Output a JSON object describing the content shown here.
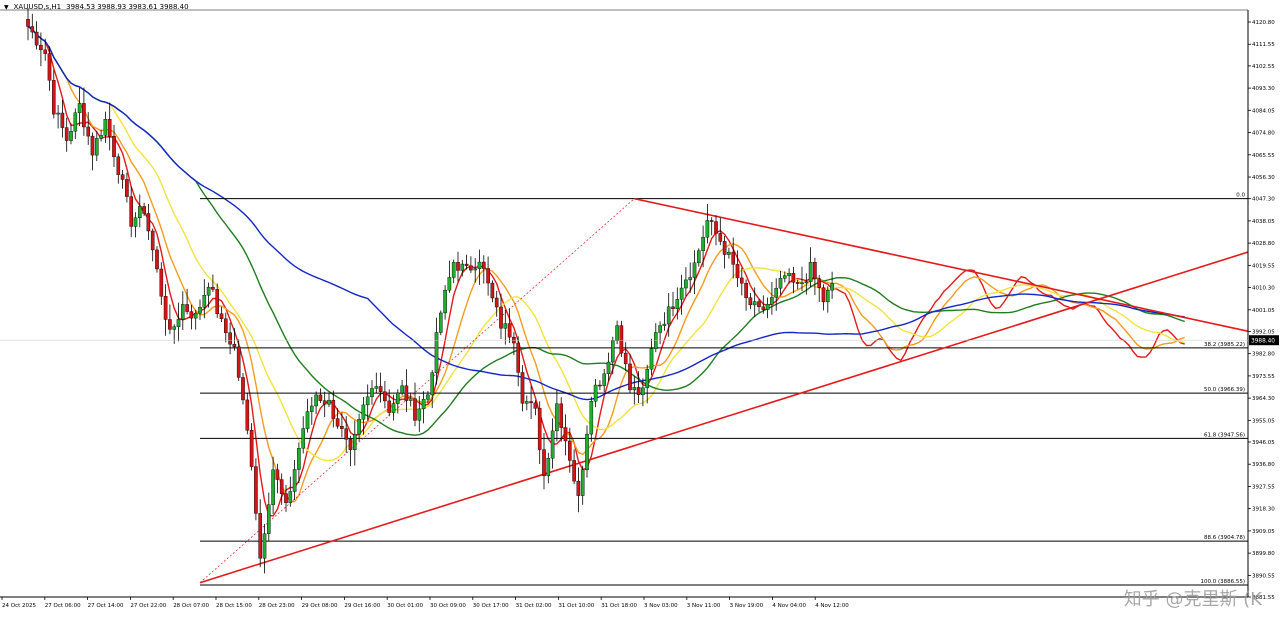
{
  "header": {
    "title": "XAUUSD,s,H1",
    "ohlc": "3984.53 3988.93 3983.61 3988.40"
  },
  "watermark": "知乎 @克里斯 (K",
  "colors": {
    "candle_up": "#1fae2e",
    "candle_down": "#d31515",
    "ma_red": "#e41a1a",
    "ma_orange": "#f59b1d",
    "ma_yellow": "#f2e43c",
    "ma_green": "#1e7d1e",
    "ma_blue": "#1226c9",
    "fib_line": "#000000",
    "trendline": "#e41a1a",
    "price_tag_bg": "#000000",
    "price_tag_text": "#ffffff"
  },
  "chart_data": {
    "type": "candlestick",
    "symbol": "XAUUSD,s,H1",
    "ylim": [
      3881.55,
      4125.8
    ],
    "y_ticks": [
      "4120.80",
      "4111.55",
      "4102.55",
      "4093.30",
      "4084.05",
      "4074.80",
      "4065.55",
      "4056.30",
      "4047.30",
      "4038.05",
      "4028.80",
      "4019.55",
      "4010.30",
      "4001.05",
      "3992.05",
      "3982.80",
      "3973.55",
      "3964.30",
      "3955.05",
      "3946.05",
      "3936.80",
      "3927.55",
      "3918.30",
      "3909.05",
      "3899.80",
      "3890.55",
      "3881.55"
    ],
    "x_labels": [
      "24 Oct 2025",
      "27 Oct 06:00",
      "27 Oct 14:00",
      "27 Oct 22:00",
      "28 Oct 07:00",
      "28 Oct 15:00",
      "28 Oct 23:00",
      "29 Oct 08:00",
      "29 Oct 16:00",
      "30 Oct 01:00",
      "30 Oct 09:00",
      "30 Oct 17:00",
      "31 Oct 02:00",
      "31 Oct 10:00",
      "31 Oct 18:00",
      "3 Nov 03:00",
      "3 Nov 11:00",
      "3 Nov 19:00",
      "4 Nov 04:00",
      "4 Nov 12:00"
    ],
    "current_price": "3988.40",
    "fib_levels": [
      {
        "label": "0.0",
        "price": 4047.3
      },
      {
        "label": "38.2 (3985.22)",
        "price": 3985.22
      },
      {
        "label": "50.0 (3966.39)",
        "price": 3966.39
      },
      {
        "label": "61.8 (3947.56)",
        "price": 3947.56
      },
      {
        "label": "88.6 (3904.78)",
        "price": 3904.78
      },
      {
        "label": "100.0 (3886.55)",
        "price": 3886.55
      }
    ],
    "trendlines": [
      {
        "name": "descending",
        "from": {
          "bar": 101,
          "price": 4047.3
        },
        "to": {
          "bar": 248,
          "price": 3990.5
        }
      },
      {
        "name": "ascending",
        "from": {
          "bar": 0,
          "price": 3887.5
        },
        "to": {
          "bar": 248,
          "price": 4027.5
        }
      }
    ],
    "guide_line": {
      "from": {
        "bar": 0,
        "price": 3887.5
      },
      "to": {
        "bar": 101,
        "price": 4047.3
      }
    },
    "anchors": [
      {
        "bar": -40,
        "price": 4119
      },
      {
        "bar": -36,
        "price": 4108
      },
      {
        "bar": -34,
        "price": 4085
      },
      {
        "bar": -31,
        "price": 4072
      },
      {
        "bar": -28,
        "price": 4086
      },
      {
        "bar": -25,
        "price": 4067
      },
      {
        "bar": -22,
        "price": 4080
      },
      {
        "bar": -19,
        "price": 4060
      },
      {
        "bar": -16,
        "price": 4038
      },
      {
        "bar": -13,
        "price": 4043
      },
      {
        "bar": -10,
        "price": 4017
      },
      {
        "bar": -7,
        "price": 3990
      },
      {
        "bar": -4,
        "price": 4003
      },
      {
        "bar": -1,
        "price": 3998
      },
      {
        "bar": 2,
        "price": 4013
      },
      {
        "bar": 5,
        "price": 3995
      },
      {
        "bar": 8,
        "price": 3985
      },
      {
        "bar": 10,
        "price": 3962
      },
      {
        "bar": 12,
        "price": 3938
      },
      {
        "bar": 14,
        "price": 3898
      },
      {
        "bar": 17,
        "price": 3935
      },
      {
        "bar": 20,
        "price": 3918
      },
      {
        "bar": 24,
        "price": 3952
      },
      {
        "bar": 27,
        "price": 3966
      },
      {
        "bar": 30,
        "price": 3962
      },
      {
        "bar": 33,
        "price": 3950
      },
      {
        "bar": 35,
        "price": 3940
      },
      {
        "bar": 38,
        "price": 3960
      },
      {
        "bar": 41,
        "price": 3972
      },
      {
        "bar": 44,
        "price": 3960
      },
      {
        "bar": 47,
        "price": 3968
      },
      {
        "bar": 50,
        "price": 3958
      },
      {
        "bar": 53,
        "price": 3966
      },
      {
        "bar": 56,
        "price": 4000
      },
      {
        "bar": 59,
        "price": 4021
      },
      {
        "bar": 62,
        "price": 4017
      },
      {
        "bar": 65,
        "price": 4023
      },
      {
        "bar": 68,
        "price": 4005
      },
      {
        "bar": 70,
        "price": 3995
      },
      {
        "bar": 73,
        "price": 3990
      },
      {
        "bar": 75,
        "price": 3965
      },
      {
        "bar": 78,
        "price": 3958
      },
      {
        "bar": 80,
        "price": 3932
      },
      {
        "bar": 83,
        "price": 3962
      },
      {
        "bar": 86,
        "price": 3940
      },
      {
        "bar": 88,
        "price": 3922
      },
      {
        "bar": 91,
        "price": 3966
      },
      {
        "bar": 94,
        "price": 3975
      },
      {
        "bar": 97,
        "price": 3995
      },
      {
        "bar": 100,
        "price": 3968
      },
      {
        "bar": 103,
        "price": 3966
      },
      {
        "bar": 106,
        "price": 3993
      },
      {
        "bar": 109,
        "price": 4000
      },
      {
        "bar": 112,
        "price": 4012
      },
      {
        "bar": 115,
        "price": 4020
      },
      {
        "bar": 118,
        "price": 4038
      },
      {
        "bar": 121,
        "price": 4030
      },
      {
        "bar": 124,
        "price": 4019
      },
      {
        "bar": 127,
        "price": 4005
      },
      {
        "bar": 130,
        "price": 4000
      },
      {
        "bar": 133,
        "price": 4005
      },
      {
        "bar": 136,
        "price": 4015
      },
      {
        "bar": 139,
        "price": 4010
      },
      {
        "bar": 142,
        "price": 4018
      },
      {
        "bar": 145,
        "price": 4005
      },
      {
        "bar": 148,
        "price": 4013
      },
      {
        "bar": 151,
        "price": 3990
      },
      {
        "bar": 154,
        "price": 3982
      },
      {
        "bar": 157,
        "price": 3995
      },
      {
        "bar": 160,
        "price": 3975
      },
      {
        "bar": 163,
        "price": 3988
      },
      {
        "bar": 166,
        "price": 3998
      },
      {
        "bar": 169,
        "price": 4005
      },
      {
        "bar": 172,
        "price": 4010
      },
      {
        "bar": 175,
        "price": 4015
      },
      {
        "bar": 178,
        "price": 4022
      },
      {
        "bar": 181,
        "price": 4005
      },
      {
        "bar": 184,
        "price": 4000
      },
      {
        "bar": 187,
        "price": 4012
      },
      {
        "bar": 190,
        "price": 4020
      },
      {
        "bar": 193,
        "price": 4005
      },
      {
        "bar": 196,
        "price": 4010
      },
      {
        "bar": 199,
        "price": 4003
      },
      {
        "bar": 202,
        "price": 4001
      },
      {
        "bar": 205,
        "price": 4007
      },
      {
        "bar": 208,
        "price": 3998
      },
      {
        "bar": 211,
        "price": 3990
      },
      {
        "bar": 214,
        "price": 3985
      },
      {
        "bar": 217,
        "price": 3978
      },
      {
        "bar": 220,
        "price": 3988
      },
      {
        "bar": 223,
        "price": 3996
      },
      {
        "bar": 226,
        "price": 3985
      },
      {
        "bar": 229,
        "price": 3988.4
      }
    ],
    "moving_averages": [
      {
        "color_key": "ma_red",
        "period": 5
      },
      {
        "color_key": "ma_orange",
        "period": 10
      },
      {
        "color_key": "ma_yellow",
        "period": 20
      },
      {
        "color_key": "ma_green",
        "period": 40
      },
      {
        "color_key": "ma_blue",
        "period": 80
      }
    ]
  }
}
